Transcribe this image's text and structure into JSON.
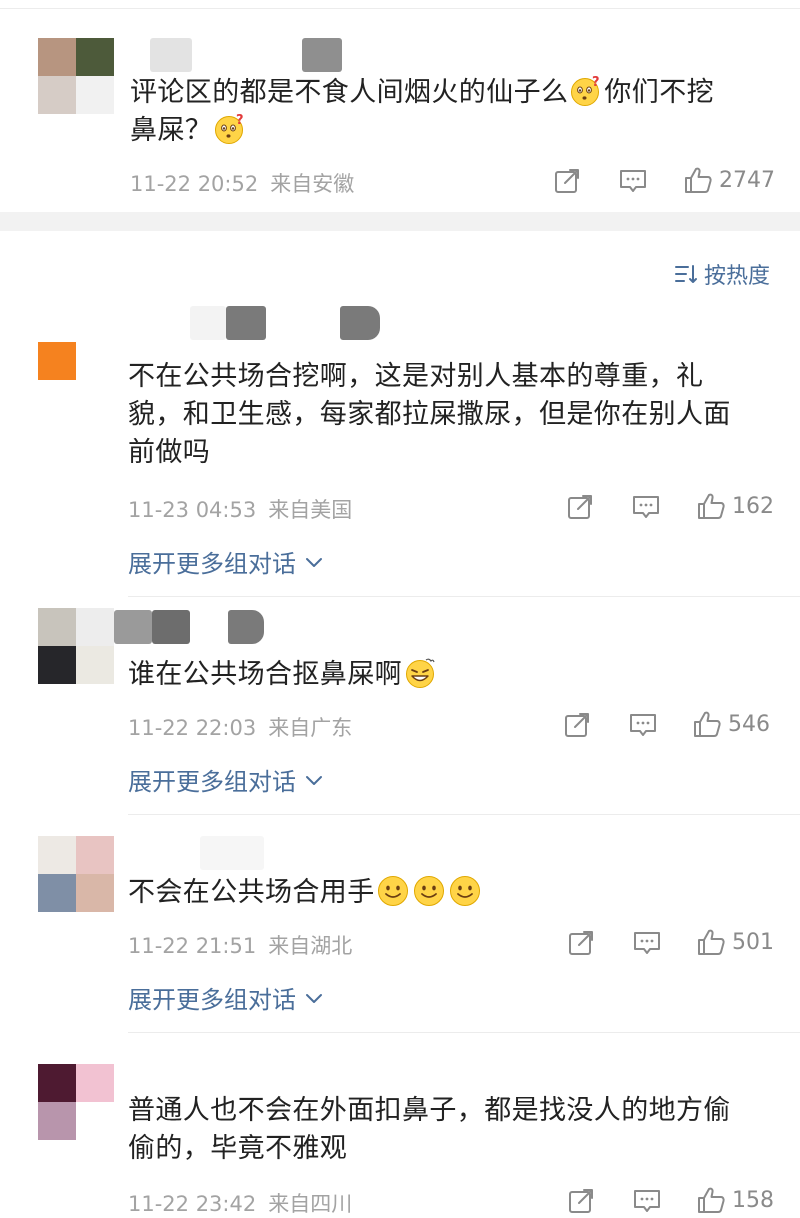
{
  "top_comment": {
    "text_line1": "评论区的都是不食人间烟火的仙子么",
    "text_line1_b": "你们不挖",
    "text_line2": "鼻屎？",
    "time": "11-22 20:52",
    "location": "来自安徽",
    "likes": "2747",
    "avatar_colors": [
      "#b79580",
      "#4d5a3a",
      "#d6ccc6",
      "#f1f1f1"
    ]
  },
  "sort": {
    "label": "按热度"
  },
  "comments": [
    {
      "text_lines": [
        "不在公共场合挖啊，这是对别人基本的尊重，礼",
        "貌，和卫生感，每家都拉屎撒尿，但是你在别人面",
        "前做吗"
      ],
      "time": "11-23 04:53",
      "location": "来自美国",
      "likes": "162",
      "expand": "展开更多组对话"
    },
    {
      "text": "谁在公共场合抠鼻屎啊",
      "time": "11-22 22:03",
      "location": "来自广东",
      "likes": "546",
      "expand": "展开更多组对话",
      "avatar_colors": [
        "#c8c4bc",
        "#ededed",
        "#26262a",
        "#ebe9e2"
      ]
    },
    {
      "text": "不会在公共场合用手",
      "time": "11-22 21:51",
      "location": "来自湖北",
      "likes": "501",
      "expand": "展开更多组对话",
      "avatar_colors": [
        "#ede9e4",
        "#e8c4c2",
        "#7f8fa6",
        "#d9b7a8"
      ]
    },
    {
      "text_lines": [
        "普通人也不会在外面扣鼻子，都是找没人的地方偷",
        "偷的，毕竟不雅观"
      ],
      "time": "11-22 23:42",
      "location": "来自四川",
      "likes": "158",
      "avatar_colors": [
        "#4e1a31",
        "#f2c2d2",
        "#b895ac",
        "#ffffff"
      ]
    }
  ],
  "colors": {
    "link": "#4a6e9a",
    "meta": "#a3a3a3",
    "text": "#222222",
    "orange_avatar": "#f5821f"
  },
  "icons": [
    "share-icon",
    "comment-icon",
    "like-icon",
    "chevron-down-icon",
    "sort-icon",
    "thinking-emoji",
    "grin-emoji",
    "smile-emoji"
  ]
}
